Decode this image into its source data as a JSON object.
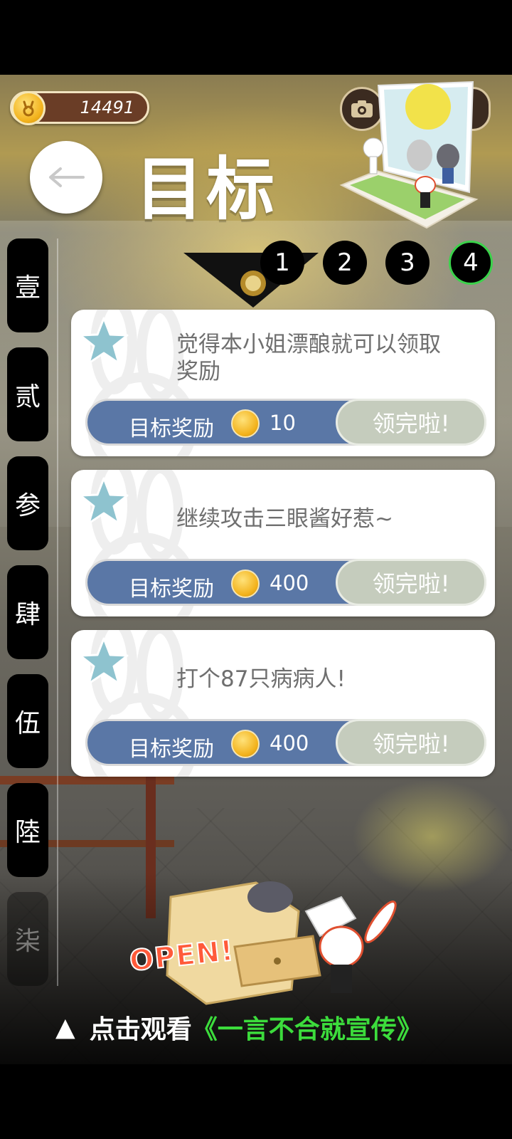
{
  "status": {
    "coins": "14491"
  },
  "header": {
    "title": "目标",
    "back_icon": "arrow-left-icon"
  },
  "side_tabs": [
    "壹",
    "贰",
    "参",
    "肆",
    "伍",
    "陸",
    "柒"
  ],
  "page_tabs": [
    {
      "label": "1",
      "active": false
    },
    {
      "label": "2",
      "active": false
    },
    {
      "label": "3",
      "active": false
    },
    {
      "label": "4",
      "active": true
    }
  ],
  "goals": [
    {
      "description": "觉得本小姐漂酿就可以领取奖励",
      "reward_label": "目标奖励",
      "reward_value": "10",
      "button": "领完啦!"
    },
    {
      "description": "继续攻击三眼酱好惹~",
      "reward_label": "目标奖励",
      "reward_value": "400",
      "button": "领完啦!"
    },
    {
      "description": "打个87只病病人!",
      "reward_label": "目标奖励",
      "reward_value": "400",
      "button": "领完啦!"
    }
  ],
  "promo": {
    "open": "OPEN!",
    "prefix": "点击观看",
    "title": "《一言不合就宣传》",
    "triangle": "▲"
  },
  "colors": {
    "reward_bar": "#5a77a6",
    "claimed_button": "#c5ccbd",
    "active_tab_ring": "#3bd24b",
    "promo_title": "#3cdc3c"
  }
}
